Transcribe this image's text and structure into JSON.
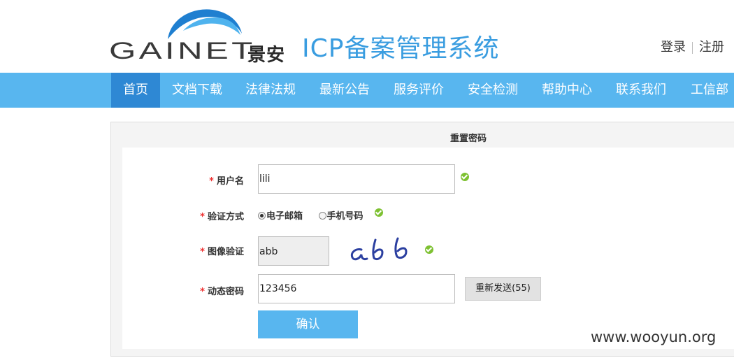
{
  "header": {
    "logo_text": "GAINET",
    "logo_cn": "景安",
    "system_title": "ICP备案管理系统",
    "login_label": "登录",
    "register_label": "注册"
  },
  "nav": {
    "items": [
      {
        "label": "首页",
        "active": true
      },
      {
        "label": "文档下载"
      },
      {
        "label": "法律法规"
      },
      {
        "label": "最新公告"
      },
      {
        "label": "服务评价"
      },
      {
        "label": "安全检测"
      },
      {
        "label": "帮助中心"
      },
      {
        "label": "联系我们"
      },
      {
        "label": "工信部"
      }
    ]
  },
  "form": {
    "title": "重置密码",
    "required_mark": "*",
    "username_label": "用户名",
    "username_value": "lili",
    "verify_method_label": "验证方式",
    "verify_options": [
      {
        "label": "电子邮箱",
        "checked": true
      },
      {
        "label": "手机号码",
        "checked": false
      }
    ],
    "image_verify_label": "图像验证",
    "image_verify_value": "abb",
    "captcha_text": "abb",
    "dynamic_code_label": "动态密码",
    "dynamic_code_value": "123456",
    "resend_label": "重新发送(55)",
    "confirm_label": "确认"
  },
  "watermark": "www.wooyun.org",
  "colors": {
    "nav_bg": "#58b6ef",
    "nav_active": "#2e88d4",
    "title_blue": "#3a9de0",
    "ok_green": "#7ec132",
    "required_red": "#e33333"
  }
}
